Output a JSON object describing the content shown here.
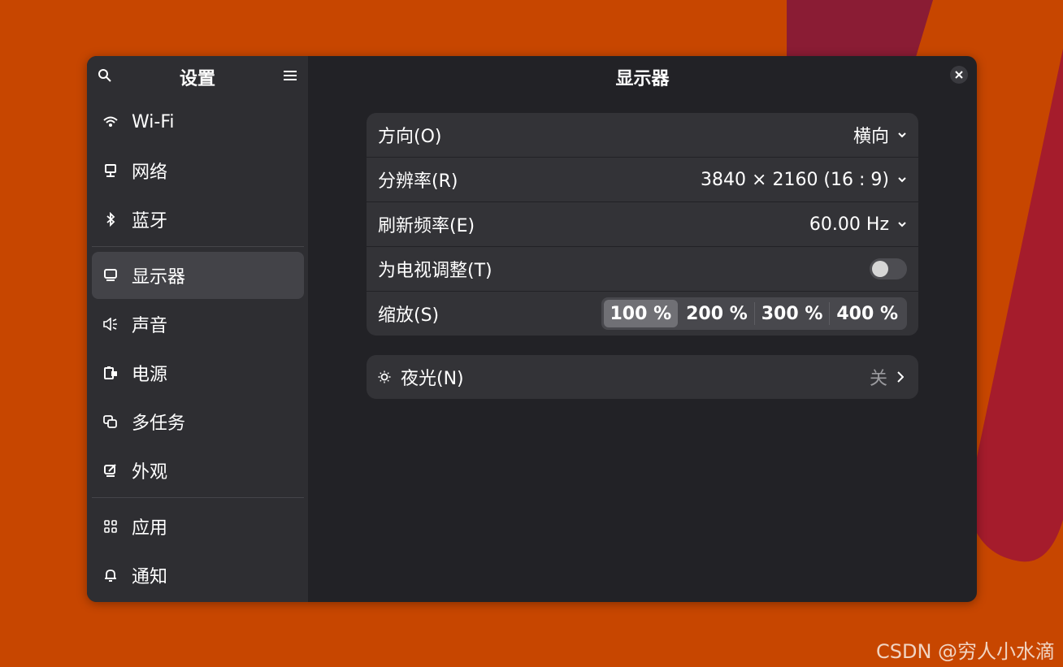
{
  "window": {
    "sidebar_title": "设置",
    "main_title": "显示器"
  },
  "sidebar": {
    "items": [
      {
        "label": "Wi-Fi",
        "icon": "wifi-icon"
      },
      {
        "label": "网络",
        "icon": "network-icon"
      },
      {
        "label": "蓝牙",
        "icon": "bluetooth-icon"
      },
      {
        "label": "显示器",
        "icon": "display-icon",
        "active": true
      },
      {
        "label": "声音",
        "icon": "sound-icon"
      },
      {
        "label": "电源",
        "icon": "power-icon"
      },
      {
        "label": "多任务",
        "icon": "multitasking-icon"
      },
      {
        "label": "外观",
        "icon": "appearance-icon"
      },
      {
        "label": "应用",
        "icon": "apps-icon"
      },
      {
        "label": "通知",
        "icon": "bell-icon"
      }
    ]
  },
  "display": {
    "orientation": {
      "label": "方向(O)",
      "value": "横向"
    },
    "resolution": {
      "label": "分辨率(R)",
      "value": "3840 × 2160 (16 : 9)"
    },
    "refresh": {
      "label": "刷新频率(E)",
      "value": "60.00 Hz"
    },
    "tv_adjust": {
      "label": "为电视调整(T)",
      "enabled": false
    },
    "scale": {
      "label": "缩放(S)",
      "options": [
        "100 %",
        "200 %",
        "300 %",
        "400 %"
      ],
      "selected": "100 %"
    }
  },
  "night_light": {
    "label": "夜光(N)",
    "value": "关"
  },
  "watermark": "CSDN @穷人小水滴",
  "colors": {
    "desktop": "#c74600",
    "stripe": "#a51c2c",
    "sidebar": "#2e2e32",
    "main": "#222226",
    "card": "#333337"
  }
}
